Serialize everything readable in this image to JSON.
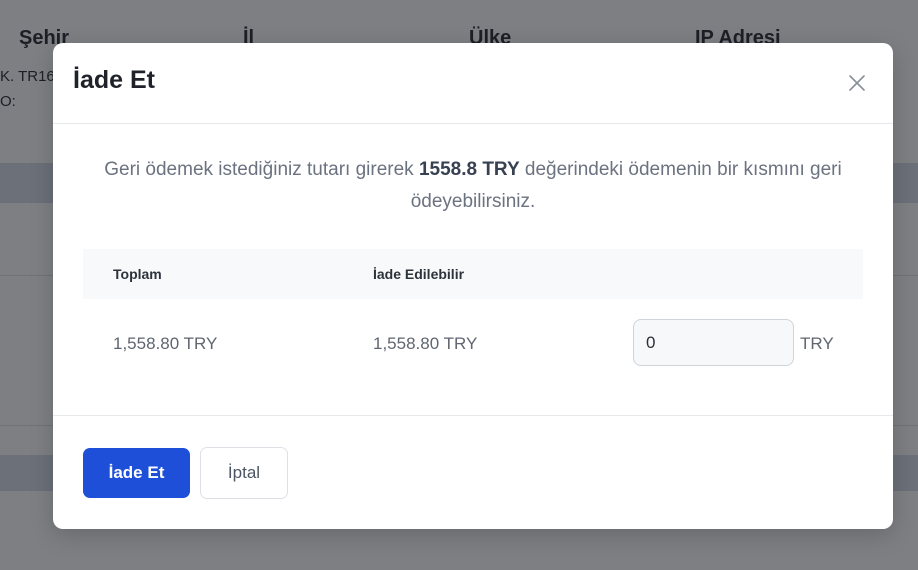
{
  "background": {
    "columns": [
      "Şehir",
      "İl",
      "Ülke",
      "IP Adresi"
    ],
    "cells": [
      "K. TR16",
      "O:"
    ]
  },
  "modal": {
    "title": "İade Et",
    "close_icon": "close-icon",
    "description": {
      "before": "Geri ödemek istediğiniz tutarı girerek ",
      "amount": "1558.8 TRY",
      "after": " değerindeki ödemenin bir kısmını geri ödeyebilirsiniz."
    },
    "table": {
      "headers": [
        "Toplam",
        "İade Edilebilir"
      ],
      "row": {
        "total": "1,558.80 TRY",
        "refundable": "1,558.80 TRY",
        "amount_value": "0",
        "currency": "TRY"
      }
    },
    "buttons": {
      "refund": "İade Et",
      "cancel": "İptal"
    }
  },
  "colors": {
    "primary": "#1d4fd8",
    "overlay": "#7d7f83"
  }
}
